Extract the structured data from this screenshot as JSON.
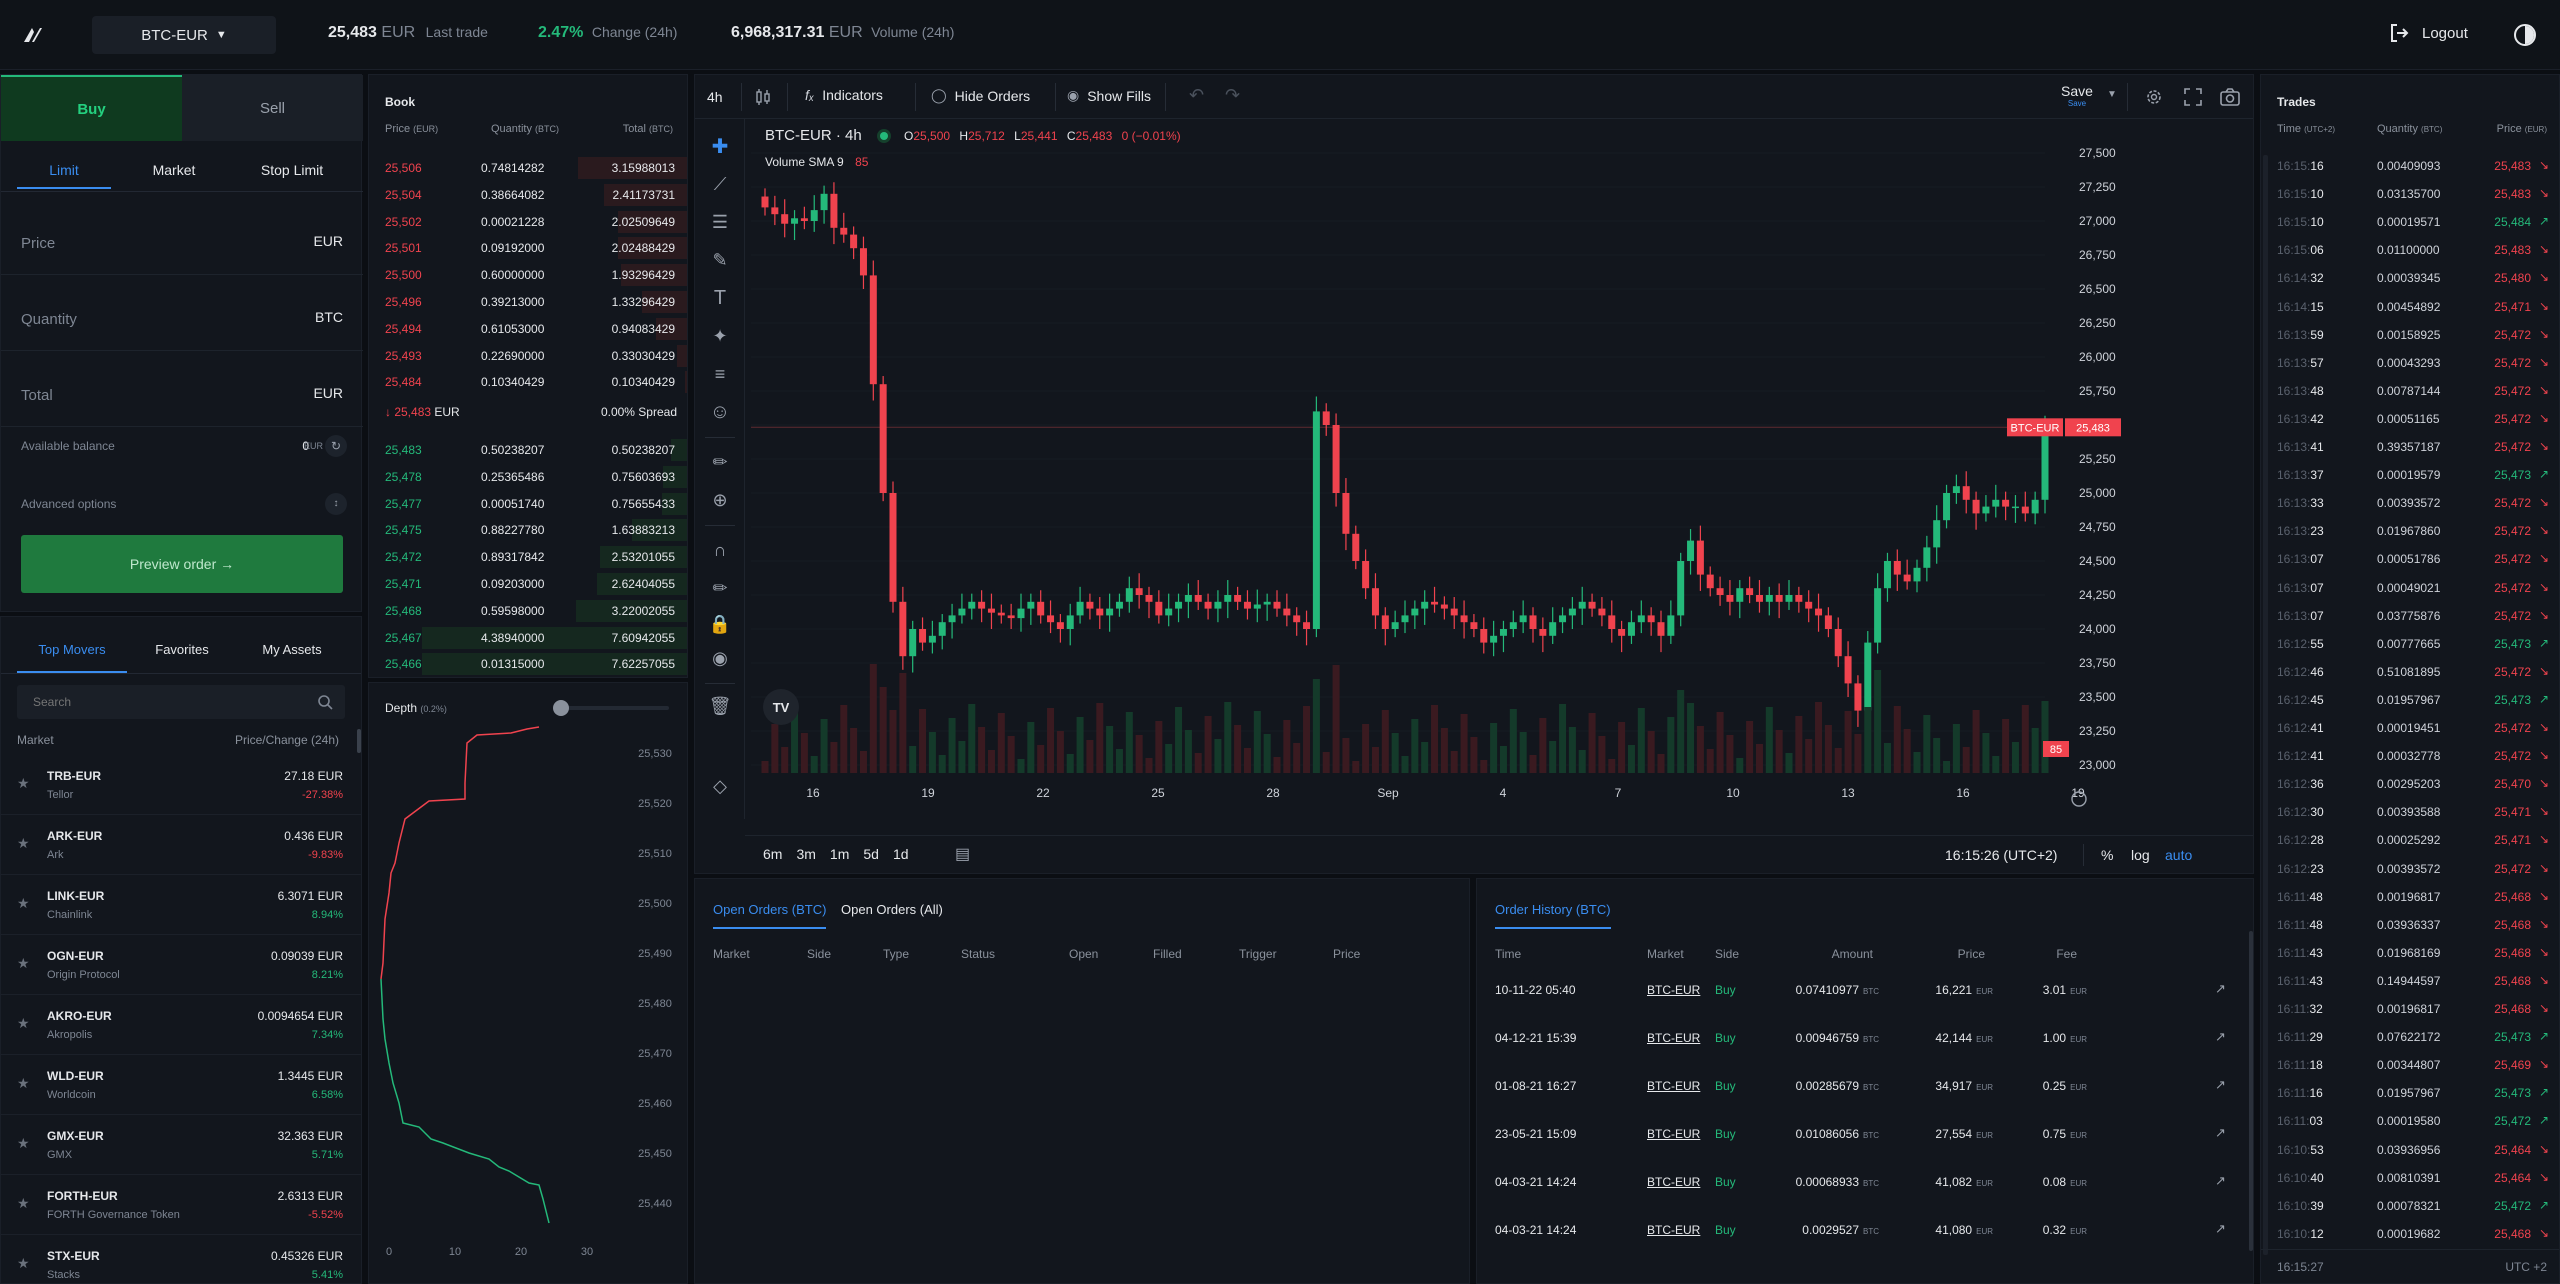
{
  "topbar": {
    "pair": "BTC-EUR",
    "last_trade_value": "25,483",
    "last_trade_unit": "EUR",
    "last_trade_label": "Last trade",
    "change_value": "2.47%",
    "change_label": "Change (24h)",
    "volume_value": "6,968,317.31",
    "volume_unit": "EUR",
    "volume_label": "Volume (24h)",
    "logout": "Logout"
  },
  "order_form": {
    "buy": "Buy",
    "sell": "Sell",
    "types": [
      "Limit",
      "Market",
      "Stop Limit"
    ],
    "price_label": "Price",
    "price_unit": "EUR",
    "quantity_label": "Quantity",
    "quantity_unit": "BTC",
    "total_label": "Total",
    "total_unit": "EUR",
    "available_label": "Available balance",
    "available_value": "0",
    "available_unit": "EUR",
    "advanced": "Advanced options",
    "preview": "Preview order →"
  },
  "movers": {
    "tabs": [
      "Top Movers",
      "Favorites",
      "My Assets"
    ],
    "search_placeholder": "Search",
    "col_market": "Market",
    "col_price": "Price/Change (24h)",
    "items": [
      {
        "pair": "TRB-EUR",
        "name": "Tellor",
        "price": "27.18 EUR",
        "change": "-27.38%",
        "neg": true
      },
      {
        "pair": "ARK-EUR",
        "name": "Ark",
        "price": "0.436 EUR",
        "change": "-9.83%",
        "neg": true
      },
      {
        "pair": "LINK-EUR",
        "name": "Chainlink",
        "price": "6.3071 EUR",
        "change": "8.94%",
        "neg": false
      },
      {
        "pair": "OGN-EUR",
        "name": "Origin Protocol",
        "price": "0.09039 EUR",
        "change": "8.21%",
        "neg": false
      },
      {
        "pair": "AKRO-EUR",
        "name": "Akropolis",
        "price": "0.0094654 EUR",
        "change": "7.34%",
        "neg": false
      },
      {
        "pair": "WLD-EUR",
        "name": "Worldcoin",
        "price": "1.3445 EUR",
        "change": "6.58%",
        "neg": false
      },
      {
        "pair": "GMX-EUR",
        "name": "GMX",
        "price": "32.363 EUR",
        "change": "5.71%",
        "neg": false
      },
      {
        "pair": "FORTH-EUR",
        "name": "FORTH Governance Token",
        "price": "2.6313 EUR",
        "change": "-5.52%",
        "neg": true
      },
      {
        "pair": "STX-EUR",
        "name": "Stacks",
        "price": "0.45326 EUR",
        "change": "5.41%",
        "neg": false
      }
    ]
  },
  "book": {
    "title": "Book",
    "col_price": "Price",
    "col_price_unit": "(EUR)",
    "col_qty": "Quantity",
    "col_qty_unit": "(BTC)",
    "col_total": "Total",
    "col_total_unit": "(BTC)",
    "asks": [
      [
        "25,506",
        "0.74814282",
        "3.15988013"
      ],
      [
        "25,504",
        "0.38664082",
        "2.41173731"
      ],
      [
        "25,502",
        "0.00021228",
        "2.02509649"
      ],
      [
        "25,501",
        "0.09192000",
        "2.02488429"
      ],
      [
        "25,500",
        "0.60000000",
        "1.93296429"
      ],
      [
        "25,496",
        "0.39213000",
        "1.33296429"
      ],
      [
        "25,494",
        "0.61053000",
        "0.94083429"
      ],
      [
        "25,493",
        "0.22690000",
        "0.33030429"
      ],
      [
        "25,484",
        "0.10340429",
        "0.10340429"
      ]
    ],
    "spread_price": "↓ 25,483",
    "spread_unit": "EUR",
    "spread_text": "0.00% Spread",
    "bids": [
      [
        "25,483",
        "0.50238207",
        "0.50238207"
      ],
      [
        "25,478",
        "0.25365486",
        "0.75603693"
      ],
      [
        "25,477",
        "0.00051740",
        "0.75655433"
      ],
      [
        "25,475",
        "0.88227780",
        "1.63883213"
      ],
      [
        "25,472",
        "0.89317842",
        "2.53201055"
      ],
      [
        "25,471",
        "0.09203000",
        "2.62404055"
      ],
      [
        "25,468",
        "0.59598000",
        "3.22002055"
      ],
      [
        "25,467",
        "4.38940000",
        "7.60942055"
      ],
      [
        "25,466",
        "0.01315000",
        "7.62257055"
      ]
    ]
  },
  "depth": {
    "title": "Depth",
    "pct": "(0.2%)",
    "y_ticks": [
      "25,530",
      "25,520",
      "25,510",
      "25,500",
      "25,490",
      "25,480",
      "25,470",
      "25,460",
      "25,450",
      "25,440"
    ],
    "x_ticks": [
      "0",
      "10",
      "20",
      "30"
    ]
  },
  "chart_toolbar": {
    "interval": "4h",
    "indicators": "Indicators",
    "hide_orders": "Hide Orders",
    "show_fills": "Show Fills",
    "save": "Save",
    "save_sub": "Save"
  },
  "chart": {
    "symbol": "BTC-EUR · 4h",
    "o_label": "O",
    "o": "25,500",
    "h_label": "H",
    "h": "25,712",
    "l_label": "L",
    "l": "25,441",
    "c_label": "C",
    "c": "25,483",
    "chg": "0 (−0.01%)",
    "vol_label": "Volume SMA 9",
    "vol_val": "85",
    "price_tag_label": "BTC-EUR",
    "price_tag": "25,483",
    "vol_tag": "85",
    "y_ticks": [
      "27,500",
      "27,250",
      "27,000",
      "26,750",
      "26,500",
      "26,250",
      "26,000",
      "25,750",
      "25,500",
      "25,250",
      "25,000",
      "24,750",
      "24,500",
      "24,250",
      "24,000",
      "23,750",
      "23,500",
      "23,250",
      "23,000"
    ],
    "x_ticks": [
      "16",
      "19",
      "22",
      "25",
      "28",
      "Sep",
      "4",
      "7",
      "10",
      "13",
      "16",
      "19"
    ],
    "ranges": [
      "6m",
      "3m",
      "1m",
      "5d",
      "1d"
    ],
    "clock": "16:15:26 (UTC+2)",
    "pct": "%",
    "log": "log",
    "auto": "auto"
  },
  "chart_data": {
    "type": "candlestick",
    "symbol": "BTC-EUR",
    "interval": "4h",
    "ylim": [
      23000,
      27500
    ],
    "closes": [
      27100,
      27050,
      26980,
      27020,
      27000,
      27080,
      27200,
      26950,
      26900,
      26800,
      26600,
      25800,
      25000,
      24200,
      23800,
      24000,
      23900,
      23950,
      24050,
      24100,
      24150,
      24200,
      24150,
      24120,
      24100,
      24080,
      24150,
      24200,
      24100,
      24050,
      24000,
      24100,
      24200,
      24150,
      24100,
      24150,
      24200,
      24300,
      24250,
      24200,
      24100,
      24150,
      24200,
      24250,
      24200,
      24150,
      24200,
      24250,
      24200,
      24150,
      24180,
      24200,
      24150,
      24100,
      24050,
      24000,
      25600,
      25500,
      25000,
      24700,
      24500,
      24300,
      24100,
      24000,
      24050,
      24100,
      24150,
      24200,
      24180,
      24150,
      24100,
      24050,
      24000,
      23900,
      23950,
      24000,
      24050,
      24100,
      24000,
      23950,
      24050,
      24100,
      24150,
      24200,
      24150,
      24100,
      24000,
      23950,
      24050,
      24100,
      24050,
      23950,
      24100,
      24500,
      24650,
      24400,
      24300,
      24250,
      24200,
      24300,
      24250,
      24200,
      24250,
      24200,
      24250,
      24200,
      24150,
      24100,
      24000,
      23800,
      23600,
      23400,
      23900,
      24300,
      24500,
      24400,
      24350,
      24450,
      24600,
      24800,
      25000,
      25050,
      24950,
      24850,
      24900,
      24950,
      24900,
      24900,
      24850,
      24950,
      25483
    ]
  },
  "orders": {
    "tabs": [
      "Open Orders (BTC)",
      "Open Orders (All)"
    ],
    "cols": [
      "Market",
      "Side",
      "Type",
      "Status",
      "Open",
      "Filled",
      "Trigger",
      "Price"
    ]
  },
  "history": {
    "title": "Order History (BTC)",
    "cols": [
      "Time",
      "Market",
      "Side",
      "Amount",
      "Price",
      "Fee"
    ],
    "rows": [
      [
        "10-11-22 05:40",
        "BTC-EUR",
        "Buy",
        "0.07410977",
        "BTC",
        "16,221",
        "EUR",
        "3.01",
        "EUR"
      ],
      [
        "04-12-21 15:39",
        "BTC-EUR",
        "Buy",
        "0.00946759",
        "BTC",
        "42,144",
        "EUR",
        "1.00",
        "EUR"
      ],
      [
        "01-08-21 16:27",
        "BTC-EUR",
        "Buy",
        "0.00285679",
        "BTC",
        "34,917",
        "EUR",
        "0.25",
        "EUR"
      ],
      [
        "23-05-21 15:09",
        "BTC-EUR",
        "Buy",
        "0.01086056",
        "BTC",
        "27,554",
        "EUR",
        "0.75",
        "EUR"
      ],
      [
        "04-03-21 14:24",
        "BTC-EUR",
        "Buy",
        "0.00068933",
        "BTC",
        "41,082",
        "EUR",
        "0.08",
        "EUR"
      ],
      [
        "04-03-21 14:24",
        "BTC-EUR",
        "Buy",
        "0.0029527",
        "BTC",
        "41,080",
        "EUR",
        "0.32",
        "EUR"
      ]
    ]
  },
  "trades": {
    "title": "Trades",
    "col_time": "Time",
    "col_time_unit": "(UTC+2)",
    "col_qty": "Quantity",
    "col_qty_unit": "(BTC)",
    "col_price": "Price",
    "col_price_unit": "(EUR)",
    "footer_time": "16:15:27",
    "footer_tz": "UTC +2",
    "rows": [
      [
        "16:15:16",
        "0.00409093",
        "25,483",
        "dn"
      ],
      [
        "16:15:10",
        "0.03135700",
        "25,483",
        "dn"
      ],
      [
        "16:15:10",
        "0.00019571",
        "25,484",
        "up"
      ],
      [
        "16:15:06",
        "0.01100000",
        "25,483",
        "dn"
      ],
      [
        "16:14:32",
        "0.00039345",
        "25,480",
        "dn"
      ],
      [
        "16:14:15",
        "0.00454892",
        "25,471",
        "dn"
      ],
      [
        "16:13:59",
        "0.00158925",
        "25,472",
        "dn"
      ],
      [
        "16:13:57",
        "0.00043293",
        "25,472",
        "dn"
      ],
      [
        "16:13:48",
        "0.00787144",
        "25,472",
        "dn"
      ],
      [
        "16:13:42",
        "0.00051165",
        "25,472",
        "dn"
      ],
      [
        "16:13:41",
        "0.39357187",
        "25,472",
        "dn"
      ],
      [
        "16:13:37",
        "0.00019579",
        "25,473",
        "up"
      ],
      [
        "16:13:33",
        "0.00393572",
        "25,472",
        "dn"
      ],
      [
        "16:13:23",
        "0.01967860",
        "25,472",
        "dn"
      ],
      [
        "16:13:07",
        "0.00051786",
        "25,472",
        "dn"
      ],
      [
        "16:13:07",
        "0.00049021",
        "25,472",
        "dn"
      ],
      [
        "16:13:07",
        "0.03775876",
        "25,472",
        "dn"
      ],
      [
        "16:12:55",
        "0.00777665",
        "25,473",
        "up"
      ],
      [
        "16:12:46",
        "0.51081895",
        "25,472",
        "dn"
      ],
      [
        "16:12:45",
        "0.01957967",
        "25,473",
        "up"
      ],
      [
        "16:12:41",
        "0.00019451",
        "25,472",
        "dn"
      ],
      [
        "16:12:41",
        "0.00032778",
        "25,472",
        "dn"
      ],
      [
        "16:12:36",
        "0.00295203",
        "25,470",
        "dn"
      ],
      [
        "16:12:30",
        "0.00393588",
        "25,471",
        "dn"
      ],
      [
        "16:12:28",
        "0.00025292",
        "25,471",
        "dn"
      ],
      [
        "16:12:23",
        "0.00393572",
        "25,472",
        "dn"
      ],
      [
        "16:11:48",
        "0.00196817",
        "25,468",
        "dn"
      ],
      [
        "16:11:48",
        "0.03936337",
        "25,468",
        "dn"
      ],
      [
        "16:11:43",
        "0.01968169",
        "25,468",
        "dn"
      ],
      [
        "16:11:43",
        "0.14944597",
        "25,468",
        "dn"
      ],
      [
        "16:11:32",
        "0.00196817",
        "25,468",
        "dn"
      ],
      [
        "16:11:29",
        "0.07622172",
        "25,473",
        "up"
      ],
      [
        "16:11:18",
        "0.00344807",
        "25,469",
        "dn"
      ],
      [
        "16:11:16",
        "0.01957967",
        "25,473",
        "up"
      ],
      [
        "16:11:03",
        "0.00019580",
        "25,472",
        "up"
      ],
      [
        "16:10:53",
        "0.03936956",
        "25,464",
        "dn"
      ],
      [
        "16:10:40",
        "0.00810391",
        "25,464",
        "dn"
      ],
      [
        "16:10:39",
        "0.00078321",
        "25,472",
        "up"
      ],
      [
        "16:10:12",
        "0.00019682",
        "25,468",
        "dn"
      ]
    ]
  },
  "colors": {
    "bg": "#0b0e13",
    "panel": "#12161d",
    "up": "#24b97a",
    "down": "#f0434e",
    "accent": "#3a8df0",
    "buy_green": "#1f7a3e"
  }
}
